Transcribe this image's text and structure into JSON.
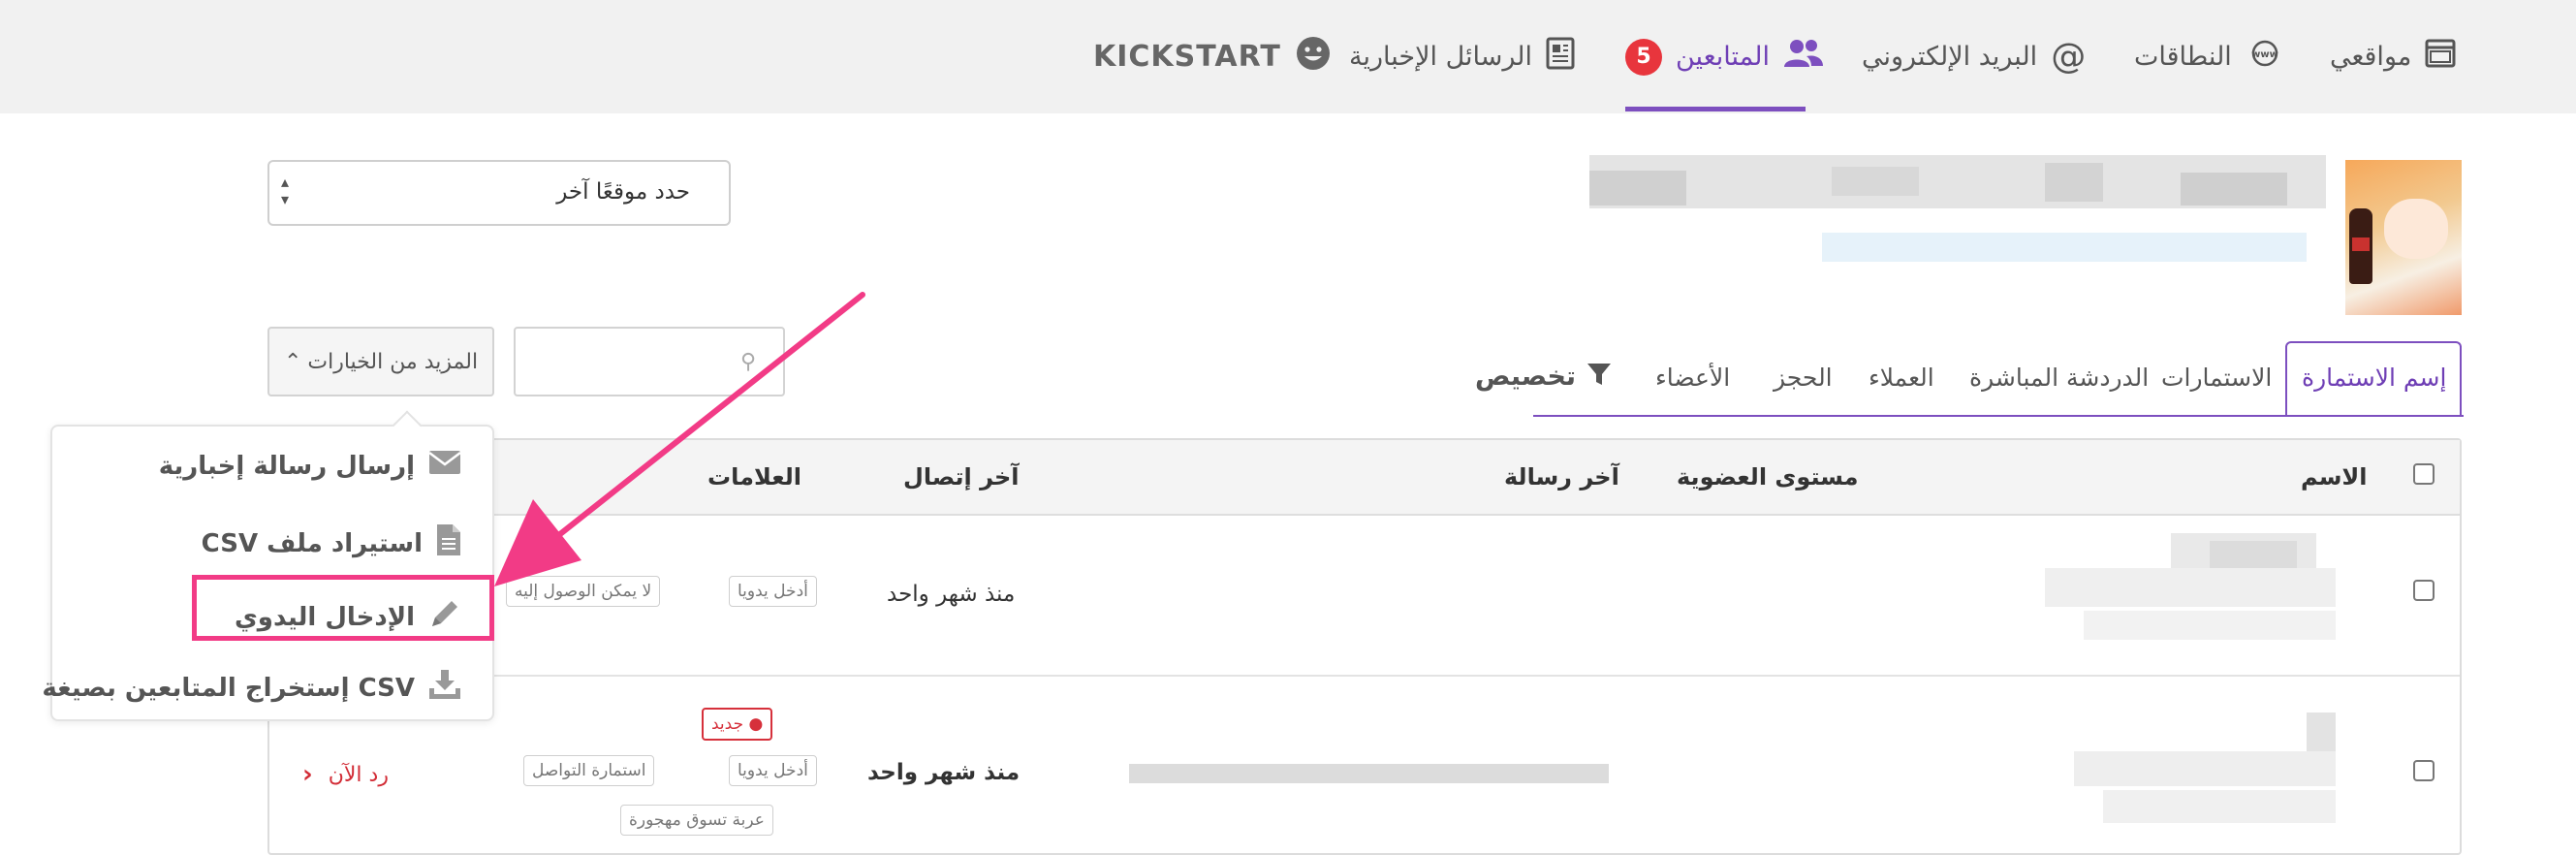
{
  "nav": {
    "items": [
      {
        "label": "مواقعي",
        "icon": "browser-window-icon"
      },
      {
        "label": "النطاقات",
        "icon": "www-globe-icon"
      },
      {
        "label": "البريد الإلكتروني",
        "icon": "at-sign-icon"
      },
      {
        "label": "المتابعين",
        "icon": "users-icon",
        "badge": "5",
        "active": true
      },
      {
        "label": "الرسائل الإخبارية",
        "icon": "newsletter-icon"
      },
      {
        "label": "KICKSTART",
        "icon": "smiley-icon"
      }
    ]
  },
  "site_select": {
    "value": "حدد موقعًا آخر"
  },
  "toolbar": {
    "more_options_label": "المزيد من الخيارات",
    "filter_label": "تخصيص"
  },
  "tabs": [
    {
      "label": "إسم الاستمارة",
      "active": true
    },
    {
      "label": "الاستمارات"
    },
    {
      "label": "الدردشة المباشرة"
    },
    {
      "label": "العملاء"
    },
    {
      "label": "الحجز"
    },
    {
      "label": "الأعضاء"
    }
  ],
  "table": {
    "headers": {
      "name": "الاسم",
      "membership": "مستوى العضوية",
      "last_message": "آخر رسالة",
      "last_contact": "آخر إتصال",
      "tags": "العلامات"
    },
    "rows": [
      {
        "last_contact": "منذ شهر واحد",
        "tags": [
          "أدخل يدويا",
          "لا يمكن الوصول إليه"
        ]
      },
      {
        "last_contact": "منذ شهر واحد",
        "new_tag": "جديد",
        "tags": [
          "أدخل يدويا",
          "استمارة التواصل",
          "عربة تسوق مهجورة"
        ],
        "reply_label": "رد الآن"
      }
    ]
  },
  "menu": {
    "items": [
      {
        "label": "إرسال رسالة إخبارية",
        "icon": "envelope-icon"
      },
      {
        "label": "استيراد ملف CSV",
        "icon": "file-icon"
      },
      {
        "label": "الإدخال اليدوي",
        "icon": "pencil-icon",
        "highlighted": true
      },
      {
        "label": "CSV إستخراج المتابعين بصيغة",
        "icon": "download-icon"
      }
    ]
  },
  "colors": {
    "accent": "#7d4fbf",
    "badge": "#e8353d",
    "annotation": "#f23b86",
    "new_tag": "#d6303b"
  }
}
